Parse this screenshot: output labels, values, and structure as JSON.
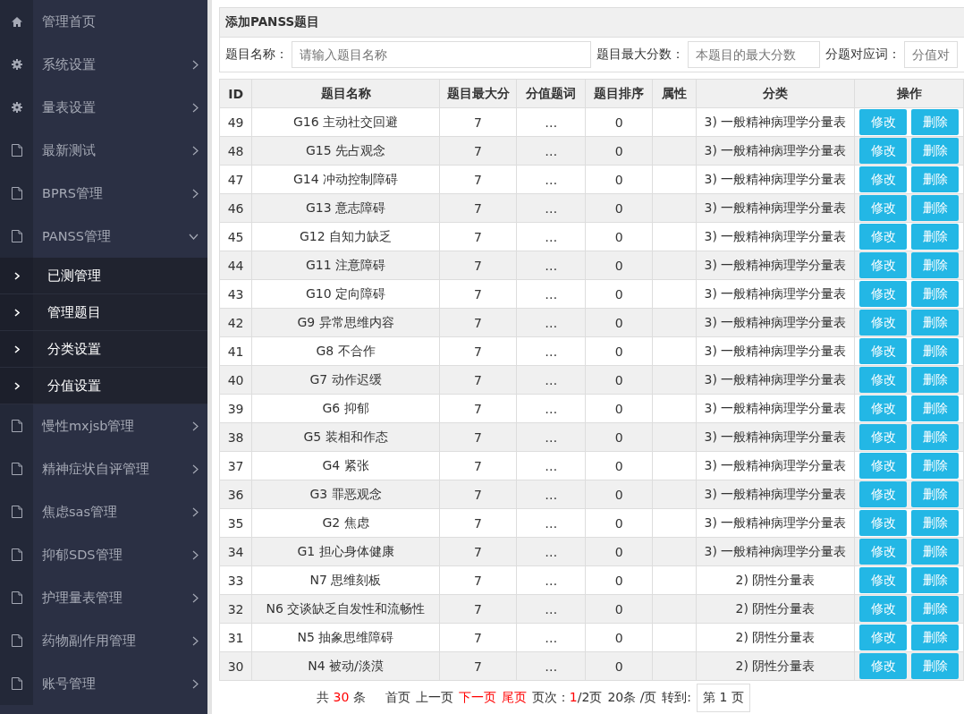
{
  "sidebar": {
    "items": [
      {
        "label": "管理首页",
        "kind": "home",
        "has_children": false
      },
      {
        "label": "系统设置",
        "kind": "gear",
        "expanded": false,
        "has_children": true
      },
      {
        "label": "量表设置",
        "kind": "gear",
        "expanded": false,
        "has_children": true
      },
      {
        "label": "最新测试",
        "kind": "file",
        "expanded": false,
        "has_children": true
      },
      {
        "label": "BPRS管理",
        "kind": "file",
        "expanded": false,
        "has_children": true
      },
      {
        "label": "PANSS管理",
        "kind": "file",
        "expanded": true,
        "has_children": true,
        "children": [
          {
            "label": "已测管理"
          },
          {
            "label": "管理题目"
          },
          {
            "label": "分类设置"
          },
          {
            "label": "分值设置"
          }
        ]
      },
      {
        "label": "慢性mxjsb管理",
        "kind": "file",
        "expanded": false,
        "has_children": true
      },
      {
        "label": "精神症状自评管理",
        "kind": "file",
        "expanded": false,
        "has_children": true
      },
      {
        "label": "焦虑sas管理",
        "kind": "file",
        "expanded": false,
        "has_children": true
      },
      {
        "label": "抑郁SDS管理",
        "kind": "file",
        "expanded": false,
        "has_children": true
      },
      {
        "label": "护理量表管理",
        "kind": "file",
        "expanded": false,
        "has_children": true
      },
      {
        "label": "药物副作用管理",
        "kind": "file",
        "expanded": false,
        "has_children": true
      },
      {
        "label": "账号管理",
        "kind": "file",
        "expanded": false,
        "has_children": true
      }
    ]
  },
  "form": {
    "title": "添加PANSS题目",
    "fields": [
      {
        "label": "题目名称：",
        "placeholder": "请输入题目名称"
      },
      {
        "label": "题目最大分数：",
        "placeholder": "本题目的最大分数"
      },
      {
        "label": "分题对应词：",
        "placeholder": "分值对"
      }
    ]
  },
  "table": {
    "columns": [
      "ID",
      "题目名称",
      "题目最大分",
      "分值题词",
      "题目排序",
      "属性",
      "分类",
      "操作"
    ],
    "rows": [
      {
        "id": "49",
        "name": "G16 主动社交回避",
        "max": "7",
        "word": "…",
        "order": "0",
        "category": "3) 一般精神病理学分量表",
        "actions": [
          "修改",
          "删除"
        ]
      },
      {
        "id": "48",
        "name": "G15 先占观念",
        "max": "7",
        "word": "…",
        "order": "0",
        "category": "3) 一般精神病理学分量表",
        "actions": [
          "修改",
          "删除"
        ]
      },
      {
        "id": "47",
        "name": "G14 冲动控制障碍",
        "max": "7",
        "word": "…",
        "order": "0",
        "category": "3) 一般精神病理学分量表",
        "actions": [
          "修改",
          "删除"
        ]
      },
      {
        "id": "46",
        "name": "G13 意志障碍",
        "max": "7",
        "word": "…",
        "order": "0",
        "category": "3) 一般精神病理学分量表",
        "actions": [
          "修改",
          "删除"
        ]
      },
      {
        "id": "45",
        "name": "G12 自知力缺乏",
        "max": "7",
        "word": "…",
        "order": "0",
        "category": "3) 一般精神病理学分量表",
        "actions": [
          "修改",
          "删除"
        ]
      },
      {
        "id": "44",
        "name": "G11 注意障碍",
        "max": "7",
        "word": "…",
        "order": "0",
        "category": "3) 一般精神病理学分量表",
        "actions": [
          "修改",
          "删除"
        ]
      },
      {
        "id": "43",
        "name": "G10 定向障碍",
        "max": "7",
        "word": "…",
        "order": "0",
        "category": "3) 一般精神病理学分量表",
        "actions": [
          "修改",
          "删除"
        ]
      },
      {
        "id": "42",
        "name": "G9 异常思维内容",
        "max": "7",
        "word": "…",
        "order": "0",
        "category": "3) 一般精神病理学分量表",
        "actions": [
          "修改",
          "删除"
        ]
      },
      {
        "id": "41",
        "name": "G8 不合作",
        "max": "7",
        "word": "…",
        "order": "0",
        "category": "3) 一般精神病理学分量表",
        "actions": [
          "修改",
          "删除"
        ]
      },
      {
        "id": "40",
        "name": "G7 动作迟缓",
        "max": "7",
        "word": "…",
        "order": "0",
        "category": "3) 一般精神病理学分量表",
        "actions": [
          "修改",
          "删除"
        ]
      },
      {
        "id": "39",
        "name": "G6 抑郁",
        "max": "7",
        "word": "…",
        "order": "0",
        "category": "3) 一般精神病理学分量表",
        "actions": [
          "修改",
          "删除"
        ]
      },
      {
        "id": "38",
        "name": "G5 装相和作态",
        "max": "7",
        "word": "…",
        "order": "0",
        "category": "3) 一般精神病理学分量表",
        "actions": [
          "修改",
          "删除"
        ]
      },
      {
        "id": "37",
        "name": "G4 紧张",
        "max": "7",
        "word": "…",
        "order": "0",
        "category": "3) 一般精神病理学分量表",
        "actions": [
          "修改",
          "删除"
        ]
      },
      {
        "id": "36",
        "name": "G3 罪恶观念",
        "max": "7",
        "word": "…",
        "order": "0",
        "category": "3) 一般精神病理学分量表",
        "actions": [
          "修改",
          "删除"
        ]
      },
      {
        "id": "35",
        "name": "G2 焦虑",
        "max": "7",
        "word": "…",
        "order": "0",
        "category": "3) 一般精神病理学分量表",
        "actions": [
          "修改",
          "删除"
        ]
      },
      {
        "id": "34",
        "name": "G1 担心身体健康",
        "max": "7",
        "word": "…",
        "order": "0",
        "category": "3) 一般精神病理学分量表",
        "actions": [
          "修改",
          "删除"
        ]
      },
      {
        "id": "33",
        "name": "N7 思维刻板",
        "max": "7",
        "word": "…",
        "order": "0",
        "category": "2) 阴性分量表",
        "actions": [
          "修改",
          "删除"
        ]
      },
      {
        "id": "32",
        "name": "N6 交谈缺乏自发性和流畅性",
        "max": "7",
        "word": "…",
        "order": "0",
        "category": "2) 阴性分量表",
        "actions": [
          "修改",
          "删除"
        ]
      },
      {
        "id": "31",
        "name": "N5 抽象思维障碍",
        "max": "7",
        "word": "…",
        "order": "0",
        "category": "2) 阴性分量表",
        "actions": [
          "修改",
          "删除"
        ]
      },
      {
        "id": "30",
        "name": "N4 被动/淡漠",
        "max": "7",
        "word": "…",
        "order": "0",
        "category": "2) 阴性分量表",
        "actions": [
          "修改",
          "删除"
        ]
      }
    ]
  },
  "pagination": {
    "total_prefix": "共",
    "total": "30",
    "total_suffix": "条",
    "links": [
      {
        "label": "首页",
        "disabled": true
      },
      {
        "label": "上一页",
        "disabled": true
      },
      {
        "label": "下一页",
        "disabled": false
      },
      {
        "label": "尾页",
        "disabled": false
      }
    ],
    "page_label": "页次：",
    "current_page": "1",
    "page_count": "/2页",
    "page_size": "20条 /页",
    "goto_label": "转到:",
    "goto_box": "第 1 页"
  }
}
